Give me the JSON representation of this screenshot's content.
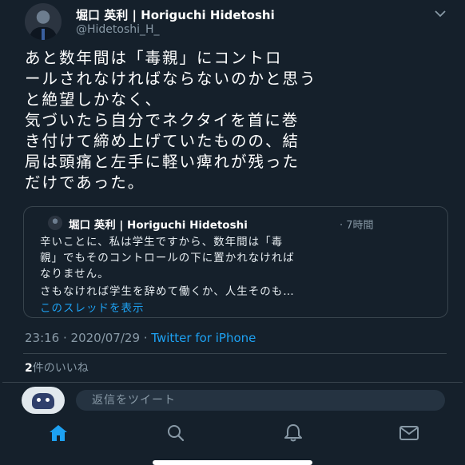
{
  "tweet": {
    "author_name": "堀口 英利 | Horiguchi Hidetoshi",
    "author_handle": "@Hidetoshi_H_",
    "text": "あと数年間は「毒親」にコントロ\nールされなければならないのかと思う\nと絶望しかなく、\n気づいたら自分でネクタイを首に巻\nき付けて締め上げていたものの、結\n局は頭痛と左手に軽い痺れが残った\nだけであった。",
    "time": "23:16 · 2020/07/29 · ",
    "source": "Twitter for iPhone",
    "likes_count": "2",
    "likes_label": "件のいいね"
  },
  "quote": {
    "author_name": "堀口 英利 | Horiguchi Hidetoshi",
    "time": "· 7時間",
    "text": "辛いことに、私は学生ですから、数年間は「毒\n親」でもそのコントロールの下に置かれなければ\nなりません。",
    "text2": "さもなければ学生を辞めて働くか、人生そのも…",
    "show_thread": "このスレッドを表示"
  },
  "reply": {
    "placeholder": "返信をツイート"
  },
  "nav": {
    "items": [
      "home-icon",
      "search-icon",
      "notifications-icon",
      "messages-icon"
    ]
  },
  "colors": {
    "background": "#15202b",
    "accent": "#1da1f2",
    "secondary_text": "#8899a6"
  }
}
